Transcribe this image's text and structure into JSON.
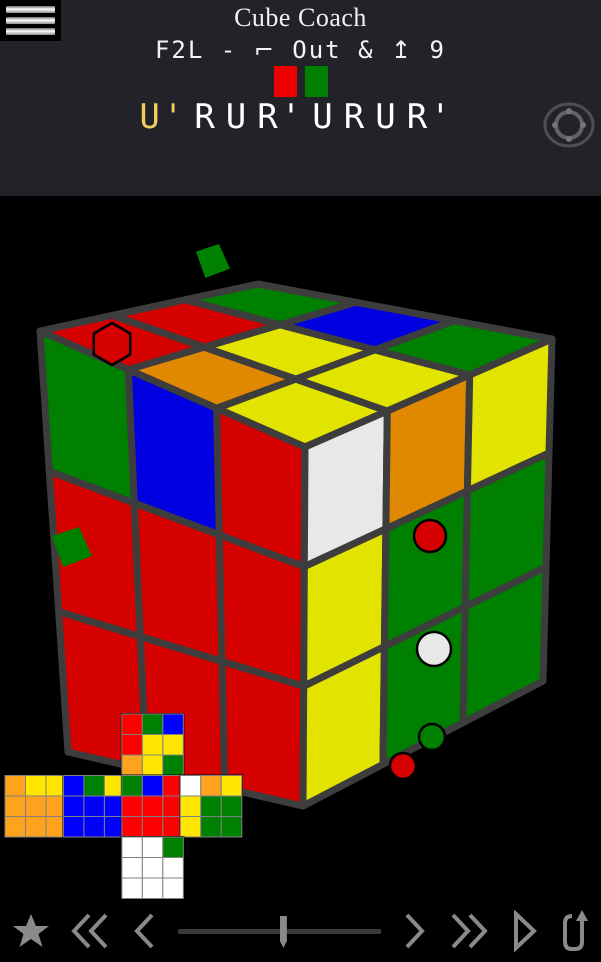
{
  "app": {
    "title": "Cube Coach",
    "subtitle_parts": [
      {
        "text": "F2L",
        "type": "text"
      },
      {
        "text": "-",
        "type": "text"
      },
      {
        "text": "⌐",
        "type": "glyph",
        "name": "corner-flag-glyph"
      },
      {
        "text": "Out",
        "type": "text"
      },
      {
        "text": "&",
        "type": "text"
      },
      {
        "text": "↥",
        "type": "glyph",
        "name": "up-arrow-bar-glyph"
      },
      {
        "text": "9",
        "type": "text"
      }
    ],
    "subtitle_plain": "F2L - ⌐ Out & ↥ 9"
  },
  "menu": {
    "icon": "hamburger-menu-icon",
    "bar_count": 3
  },
  "gyro": {
    "icon": "rotation-gyro-icon"
  },
  "pair_swatches": [
    {
      "name": "swatch-red",
      "color": "#ee0000"
    },
    {
      "name": "swatch-green",
      "color": "#008000"
    }
  ],
  "moves": {
    "sequence": [
      "U'",
      "R",
      "U",
      "R'",
      "U",
      "R",
      "U",
      "R'"
    ],
    "current_index": 0,
    "current_color": "#f2cd5c",
    "normal_color": "#ffffff"
  },
  "palette": {
    "red": "#d50000",
    "green": "#008000",
    "blue": "#0000e0",
    "yellow": "#e3e300",
    "orange": "#e08800",
    "white": "#e8e8e8",
    "net_yellow": "#ffe600",
    "net_red": "#ff0000",
    "net_green": "#008000",
    "net_blue": "#0000ff",
    "net_orange": "#ffa21e",
    "net_white": "#ffffff",
    "cube_edge": "#3d3d3d",
    "header_bg": "#212328",
    "canvas_bg": "#000000"
  },
  "cube3d": {
    "top_face": [
      [
        "red",
        "red",
        "green"
      ],
      [
        "orange",
        "yellow",
        "blue"
      ],
      [
        "yellow",
        "yellow",
        "green"
      ]
    ],
    "left_face": [
      [
        "green",
        "blue",
        "red"
      ],
      [
        "red",
        "red",
        "red"
      ],
      [
        "red",
        "red",
        "red"
      ]
    ],
    "right_face": [
      [
        "white",
        "orange",
        "yellow"
      ],
      [
        "yellow",
        "green",
        "green"
      ],
      [
        "yellow",
        "green",
        "green"
      ]
    ],
    "markers": [
      {
        "name": "marker-red-corner-top",
        "color": "red",
        "shape": "hexagon"
      },
      {
        "name": "marker-green-floating-top",
        "color": "green",
        "shape": "cube"
      },
      {
        "name": "marker-green-floating-left",
        "color": "green",
        "shape": "cube"
      },
      {
        "name": "marker-red-dot-right",
        "color": "red",
        "shape": "circle"
      },
      {
        "name": "marker-white-dot-right",
        "color": "white",
        "shape": "circle"
      },
      {
        "name": "marker-green-dot-below",
        "color": "green",
        "shape": "circle"
      },
      {
        "name": "marker-red-dot-below",
        "color": "red",
        "shape": "circle"
      }
    ]
  },
  "net": {
    "up": [
      [
        "red",
        "green",
        "blue"
      ],
      [
        "red",
        "yellow",
        "yellow"
      ],
      [
        "orange",
        "yellow",
        "green"
      ]
    ],
    "left": [
      [
        "orange",
        "yellow",
        "yellow"
      ],
      [
        "orange",
        "orange",
        "orange"
      ],
      [
        "orange",
        "orange",
        "orange"
      ]
    ],
    "front": [
      [
        "blue",
        "green",
        "yellow"
      ],
      [
        "blue",
        "blue",
        "blue"
      ],
      [
        "blue",
        "blue",
        "blue"
      ]
    ],
    "right": [
      [
        "green",
        "blue",
        "red"
      ],
      [
        "red",
        "red",
        "red"
      ],
      [
        "red",
        "red",
        "red"
      ]
    ],
    "back": [
      [
        "white",
        "orange",
        "yellow"
      ],
      [
        "yellow",
        "green",
        "green"
      ],
      [
        "yellow",
        "green",
        "green"
      ]
    ],
    "down": [
      [
        "white",
        "white",
        "green"
      ],
      [
        "white",
        "white",
        "white"
      ],
      [
        "white",
        "white",
        "white"
      ]
    ]
  },
  "toolbar": {
    "buttons": [
      {
        "name": "favorite-button",
        "icon": "star-icon",
        "label": "Favorite"
      },
      {
        "name": "first-button",
        "icon": "double-chevron-left-icon",
        "label": "First"
      },
      {
        "name": "previous-button",
        "icon": "chevron-left-icon",
        "label": "Previous"
      },
      {
        "name": "next-button",
        "icon": "chevron-right-icon",
        "label": "Next"
      },
      {
        "name": "last-button",
        "icon": "double-chevron-right-icon",
        "label": "Last"
      },
      {
        "name": "play-button",
        "icon": "play-triangle-icon",
        "label": "Play"
      },
      {
        "name": "repeat-button",
        "icon": "loop-arrow-icon",
        "label": "Repeat"
      }
    ],
    "slider": {
      "name": "progress-slider",
      "value": 52,
      "min": 0,
      "max": 100
    }
  }
}
